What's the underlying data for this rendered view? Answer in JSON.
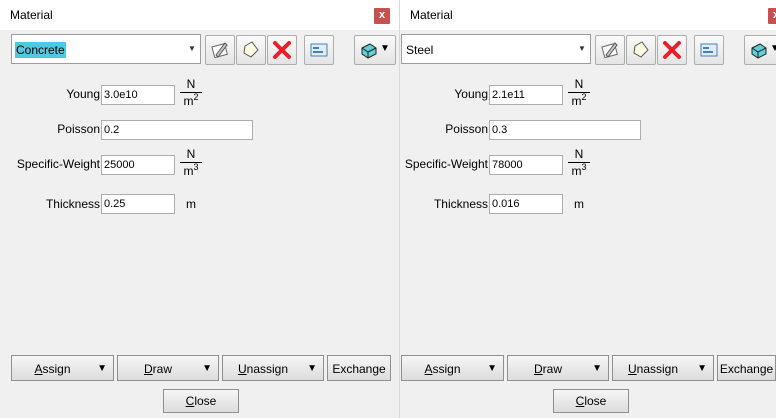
{
  "panels": [
    {
      "title": "Material",
      "close_glyph": "x",
      "material": "Concrete",
      "material_selected": true,
      "fields": [
        {
          "label": "Young",
          "value": "3.0e10",
          "unit_num": "N",
          "unit_den": "m",
          "unit_exp": "2"
        },
        {
          "label": "Poisson",
          "value": "0.2"
        },
        {
          "label": "Specific-Weight",
          "value": "25000",
          "unit_num": "N",
          "unit_den": "m",
          "unit_exp": "3"
        },
        {
          "label": "Thickness",
          "value": "0.25",
          "unit": "m"
        }
      ],
      "actions": [
        {
          "label": "Assign",
          "mnemonic": "A",
          "rest": "ssign"
        },
        {
          "label": "Draw",
          "mnemonic": "D",
          "rest": "raw"
        },
        {
          "label": "Unassign",
          "mnemonic": "U",
          "rest": "nassign"
        },
        {
          "label": "Exchange"
        }
      ],
      "close": {
        "mnemonic": "C",
        "rest": "lose"
      }
    },
    {
      "title": "Material",
      "close_glyph": "x",
      "material": "Steel",
      "material_selected": false,
      "fields": [
        {
          "label": "Young",
          "value": "2.1e11",
          "unit_num": "N",
          "unit_den": "m",
          "unit_exp": "2"
        },
        {
          "label": "Poisson",
          "value": "0.3"
        },
        {
          "label": "Specific-Weight",
          "value": "78000",
          "unit_num": "N",
          "unit_den": "m",
          "unit_exp": "3"
        },
        {
          "label": "Thickness",
          "value": "0.016",
          "unit": "m"
        }
      ],
      "actions": [
        {
          "label": "Assign",
          "mnemonic": "A",
          "rest": "ssign"
        },
        {
          "label": "Draw",
          "mnemonic": "D",
          "rest": "raw"
        },
        {
          "label": "Unassign",
          "mnemonic": "U",
          "rest": "nassign"
        },
        {
          "label": "Exchange"
        }
      ],
      "close": {
        "mnemonic": "C",
        "rest": "lose"
      }
    }
  ],
  "toolbar_icons": [
    "edit-icon",
    "new-material-icon",
    "delete-icon",
    "properties-icon",
    "layer-icon"
  ],
  "colors": {
    "selection": "#4fc9e0",
    "close_button": "#c75050",
    "delete_red": "#e8202a"
  }
}
